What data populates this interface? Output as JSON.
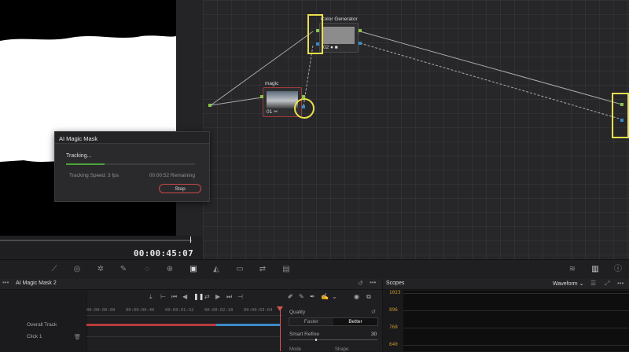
{
  "timecode": "00:00:45:07",
  "nodes": [
    {
      "title": "Color Generator",
      "number": "02",
      "badge_icons": "● ■"
    },
    {
      "title": "magic",
      "number": "01",
      "badge_icons": "✂"
    }
  ],
  "dialog": {
    "title": "AI Magic Mask",
    "status": "Tracking...",
    "progress": 0.3,
    "speed": "Tracking Speed: 3 fps",
    "remaining": "00:00:52 Remaining",
    "stop_label": "Stop"
  },
  "toolbar_icons": [
    "curves-icon",
    "color-warper-icon",
    "qualifier-icon",
    "picker-icon",
    "window-icon",
    "tracker-icon",
    "magic-mask-icon",
    "blur-icon",
    "key-icon",
    "sizing-icon",
    "3d-icon",
    "scopes-toggle-icon",
    "info-icon"
  ],
  "mask_panel": {
    "title": "AI Magic Mask 2",
    "tracks": [
      "Overall Track",
      "Click 1"
    ],
    "ruler": [
      "00:00:00:00",
      "00:00:00:46",
      "00:00:01:32",
      "00:00:02:18",
      "00:00:03:04"
    ],
    "overall_progress": 0.67,
    "quality_label": "Quality",
    "quality_options": [
      "Faster",
      "Better"
    ],
    "quality_selected": "Better",
    "smart_refine_label": "Smart Refine",
    "smart_refine_value": "30",
    "mode_label": "Mode",
    "shape_label": "Shape"
  },
  "scopes": {
    "title": "Scopes",
    "mode": "Waveform",
    "labels": [
      "1023",
      "896",
      "768",
      "640"
    ]
  },
  "colors": {
    "highlight": "#e8e04a",
    "progress_green": "#4aa33a",
    "stop_red": "#c94848",
    "track_red": "#b83b3b",
    "track_blue": "#3a8bc8",
    "scope_label": "#c9962f"
  }
}
